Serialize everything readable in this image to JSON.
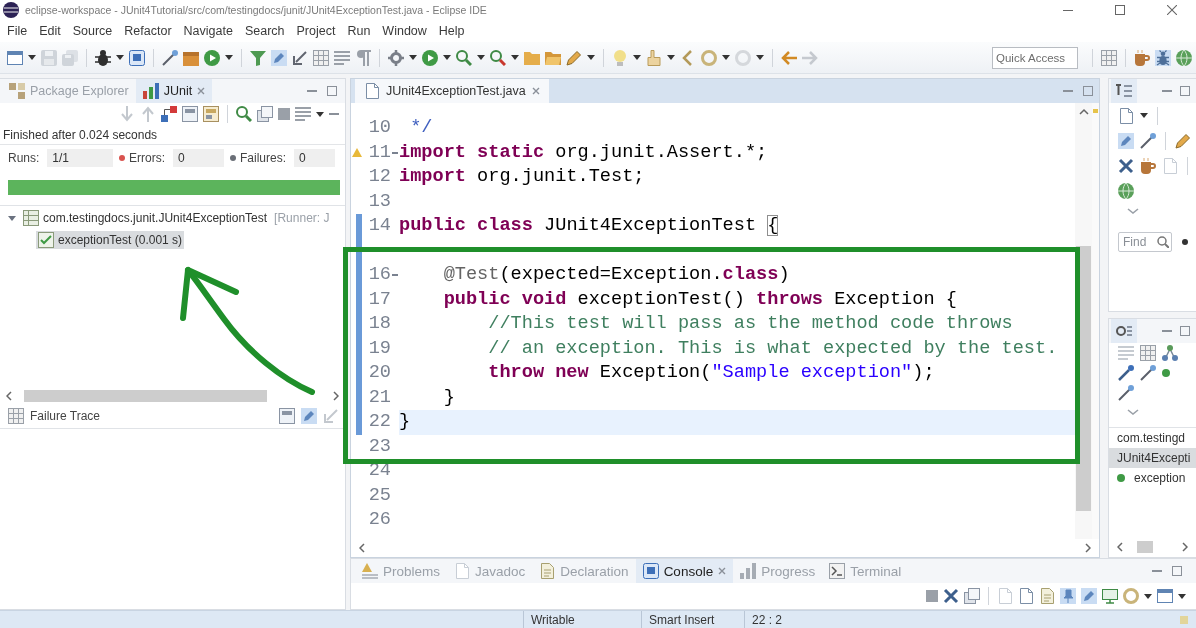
{
  "window": {
    "title": "eclipse-workspace - JUnit4Tutorial/src/com/testingdocs/junit/JUnit4ExceptionTest.java - Eclipse IDE"
  },
  "menu": [
    "File",
    "Edit",
    "Source",
    "Refactor",
    "Navigate",
    "Search",
    "Project",
    "Run",
    "Window",
    "Help"
  ],
  "toolbar": {
    "quick_access": {
      "placeholder": "Quick Access"
    }
  },
  "junit_view": {
    "tabs": [
      {
        "label": "Package Explorer",
        "selected": false
      },
      {
        "label": "JUnit",
        "selected": true
      }
    ],
    "status": "Finished after 0.024 seconds",
    "counters": [
      {
        "kind": "runs",
        "label": "Runs:",
        "value": "1/1"
      },
      {
        "kind": "errors",
        "label": "Errors:",
        "value": "0"
      },
      {
        "kind": "failures",
        "label": "Failures:",
        "value": "0"
      }
    ],
    "progress": {
      "level": 1
    },
    "tree": [
      {
        "label": "com.testingdocs.junit.JUnit4ExceptionTest",
        "runner": "[Runner: J",
        "expanded": true,
        "selected": false,
        "children": [
          {
            "label": "exceptionTest (0.001 s)",
            "selected": true
          }
        ]
      }
    ],
    "trace_title": "Failure Trace"
  },
  "editor": {
    "tabs": [
      {
        "label": "JUnit4ExceptionTest.java",
        "selected": true
      }
    ],
    "lines": [
      {
        "number": "10",
        "changed": false,
        "current": false,
        "fold": false,
        "warning": false,
        "tokens": [
          {
            "kind": "doc",
            "text": " */"
          }
        ]
      },
      {
        "number": "11",
        "changed": false,
        "current": false,
        "fold": true,
        "warning": true,
        "tokens": [
          {
            "kind": "keyword",
            "text": "import "
          },
          {
            "kind": "keyword",
            "text": "static "
          },
          {
            "kind": "plain",
            "text": "org.junit.Assert.*;"
          }
        ]
      },
      {
        "number": "12",
        "changed": false,
        "current": false,
        "fold": false,
        "warning": false,
        "tokens": [
          {
            "kind": "keyword",
            "text": "import "
          },
          {
            "kind": "plain",
            "text": "org.junit.Test;"
          }
        ]
      },
      {
        "number": "13",
        "changed": false,
        "current": false,
        "fold": false,
        "warning": false
      },
      {
        "number": "14",
        "changed": true,
        "current": false,
        "fold": false,
        "warning": false,
        "tokens": [
          {
            "kind": "keyword",
            "text": "public "
          },
          {
            "kind": "keyword",
            "text": "class "
          },
          {
            "kind": "plain",
            "text": "JUnit4ExceptionTest "
          },
          {
            "kind": "bracket",
            "text": "{"
          }
        ],
        "children": [
          {
            "changed": true,
            "current": false,
            "fold": false,
            "warning": false
          },
          {
            "number": "16",
            "changed": true,
            "current": false,
            "fold": true,
            "warning": false,
            "tokens": [
              {
                "kind": "annotation",
                "text": "@Test"
              },
              {
                "kind": "plain",
                "text": "(expected=Exception."
              },
              {
                "kind": "keyword",
                "text": "class"
              },
              {
                "kind": "plain",
                "text": ")"
              }
            ]
          },
          {
            "number": "17",
            "changed": true,
            "current": false,
            "fold": false,
            "warning": false,
            "tokens": [
              {
                "kind": "keyword",
                "text": "public "
              },
              {
                "kind": "keyword",
                "text": "void "
              },
              {
                "kind": "plain",
                "text": "exceptionTest() "
              },
              {
                "kind": "keyword",
                "text": "throws "
              },
              {
                "kind": "plain",
                "text": "Exception {"
              }
            ],
            "children": [
              {
                "number": "18",
                "changed": true,
                "current": false,
                "fold": false,
                "warning": false,
                "tokens": [
                  {
                    "kind": "comment",
                    "text": "//This test will pass as the method code throws"
                  }
                ]
              },
              {
                "number": "19",
                "changed": true,
                "current": false,
                "fold": false,
                "warning": false,
                "tokens": [
                  {
                    "kind": "comment",
                    "text": "// an exception. This is what expected by the test."
                  }
                ]
              },
              {
                "number": "20",
                "changed": true,
                "current": false,
                "fold": false,
                "warning": false,
                "tokens": [
                  {
                    "kind": "keyword",
                    "text": "throw "
                  },
                  {
                    "kind": "keyword",
                    "text": "new "
                  },
                  {
                    "kind": "plain",
                    "text": "Exception("
                  },
                  {
                    "kind": "string",
                    "text": "\"Sample exception\""
                  },
                  {
                    "kind": "plain",
                    "text": ");"
                  }
                ]
              }
            ]
          },
          {
            "number": "21",
            "changed": true,
            "current": false,
            "fold": false,
            "warning": false,
            "tokens": [
              {
                "kind": "plain",
                "text": "}"
              }
            ]
          }
        ]
      },
      {
        "number": "22",
        "changed": true,
        "current": true,
        "fold": false,
        "warning": false,
        "tokens": [
          {
            "kind": "plain",
            "text": "}"
          }
        ]
      },
      {
        "number": "23",
        "changed": false,
        "current": false,
        "fold": false,
        "warning": false
      },
      {
        "number": "24",
        "changed": false,
        "current": false,
        "fold": false,
        "warning": false
      },
      {
        "number": "25",
        "changed": false,
        "current": false,
        "fold": false,
        "warning": false
      },
      {
        "number": "26",
        "changed": false,
        "current": false,
        "fold": false,
        "warning": false
      }
    ]
  },
  "task_view": {
    "search": {
      "placeholder": "Find"
    }
  },
  "outline": {
    "items": [
      {
        "label": "com.testingd",
        "selected": false
      },
      {
        "label": "JUnit4Excepti",
        "selected": true,
        "children": [
          {
            "label": "exception",
            "selected": false
          }
        ]
      }
    ]
  },
  "console_view": {
    "tabs": [
      {
        "label": "Problems",
        "selected": false
      },
      {
        "label": "Javadoc",
        "selected": false
      },
      {
        "label": "Declaration",
        "selected": false
      },
      {
        "label": "Console",
        "selected": true
      },
      {
        "label": "Progress",
        "selected": false
      },
      {
        "label": "Terminal",
        "selected": false
      }
    ]
  },
  "status_bar": [
    "Writable",
    "Smart Insert",
    "22 : 2"
  ]
}
